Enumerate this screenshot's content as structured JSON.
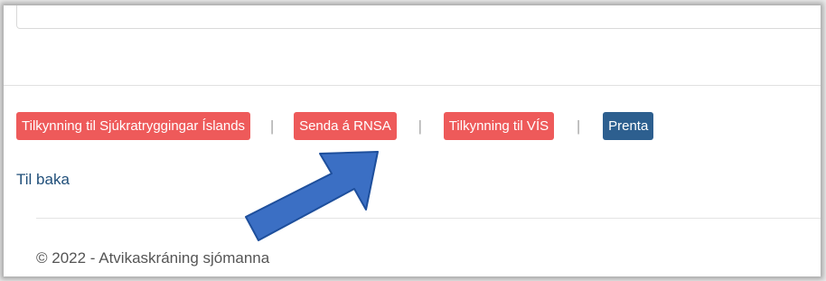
{
  "actions": {
    "sjukratryggingar_label": "Tilkynning til Sjúkratryggingar Íslands",
    "rnsa_label": "Senda á RNSA",
    "vis_label": "Tilkynning til VÍS",
    "print_label": "Prenta",
    "separator": "|"
  },
  "navigation": {
    "back_label": "Til baka"
  },
  "footer": {
    "copyright": "© 2022 - Atvikaskráning sjómanna"
  },
  "colors": {
    "danger_button": "#ee5a5a",
    "primary_button": "#2d5f8f",
    "link": "#1f4e79",
    "annotation_arrow": "#3b6fc4"
  },
  "annotation": {
    "icon": "arrow-icon"
  }
}
